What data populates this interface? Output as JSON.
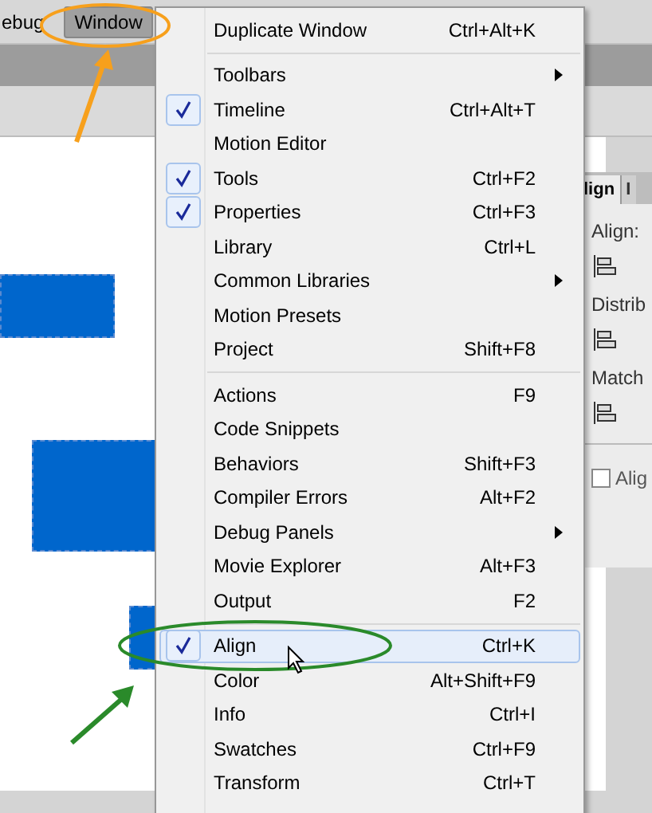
{
  "menu_bar": [
    {
      "label": "ebug",
      "selected": false
    },
    {
      "label": "Window",
      "selected": true
    }
  ],
  "window_menu": {
    "sections": [
      [
        {
          "label": "Duplicate Window",
          "shortcut": "Ctrl+Alt+K",
          "checked": false,
          "submenu": false,
          "highlighted": false
        }
      ],
      [
        {
          "label": "Toolbars",
          "checked": false,
          "submenu": true,
          "highlighted": false
        },
        {
          "label": "Timeline",
          "shortcut": "Ctrl+Alt+T",
          "checked": true,
          "submenu": false,
          "highlighted": false
        },
        {
          "label": "Motion Editor",
          "checked": false,
          "submenu": false,
          "highlighted": false
        },
        {
          "label": "Tools",
          "shortcut": "Ctrl+F2",
          "checked": true,
          "submenu": false,
          "highlighted": false
        },
        {
          "label": "Properties",
          "shortcut": "Ctrl+F3",
          "checked": true,
          "submenu": false,
          "highlighted": false
        },
        {
          "label": "Library",
          "shortcut": "Ctrl+L",
          "checked": false,
          "submenu": false,
          "highlighted": false
        },
        {
          "label": "Common Libraries",
          "checked": false,
          "submenu": true,
          "highlighted": false
        },
        {
          "label": "Motion Presets",
          "checked": false,
          "submenu": false,
          "highlighted": false
        },
        {
          "label": "Project",
          "shortcut": "Shift+F8",
          "checked": false,
          "submenu": false,
          "highlighted": false
        }
      ],
      [
        {
          "label": "Actions",
          "shortcut": "F9",
          "checked": false,
          "submenu": false,
          "highlighted": false
        },
        {
          "label": "Code Snippets",
          "checked": false,
          "submenu": false,
          "highlighted": false
        },
        {
          "label": "Behaviors",
          "shortcut": "Shift+F3",
          "checked": false,
          "submenu": false,
          "highlighted": false
        },
        {
          "label": "Compiler Errors",
          "shortcut": "Alt+F2",
          "checked": false,
          "submenu": false,
          "highlighted": false
        },
        {
          "label": "Debug Panels",
          "checked": false,
          "submenu": true,
          "highlighted": false
        },
        {
          "label": "Movie Explorer",
          "shortcut": "Alt+F3",
          "checked": false,
          "submenu": false,
          "highlighted": false
        },
        {
          "label": "Output",
          "shortcut": "F2",
          "checked": false,
          "submenu": false,
          "highlighted": false
        }
      ],
      [
        {
          "label": "Align",
          "shortcut": "Ctrl+K",
          "checked": true,
          "submenu": false,
          "highlighted": true
        },
        {
          "label": "Color",
          "shortcut": "Alt+Shift+F9",
          "checked": false,
          "submenu": false,
          "highlighted": false
        },
        {
          "label": "Info",
          "shortcut": "Ctrl+I",
          "checked": false,
          "submenu": false,
          "highlighted": false
        },
        {
          "label": "Swatches",
          "shortcut": "Ctrl+F9",
          "checked": false,
          "submenu": false,
          "highlighted": false
        },
        {
          "label": "Transform",
          "shortcut": "Ctrl+T",
          "checked": false,
          "submenu": false,
          "highlighted": false
        }
      ]
    ]
  },
  "align_panel": {
    "tabs": [
      {
        "label": "lign",
        "selected": true
      },
      {
        "label": "I",
        "selected": false
      }
    ],
    "labels": [
      "Align:",
      "Distrib",
      "Match"
    ],
    "checkbox": {
      "label": "Alig",
      "checked": false
    }
  }
}
